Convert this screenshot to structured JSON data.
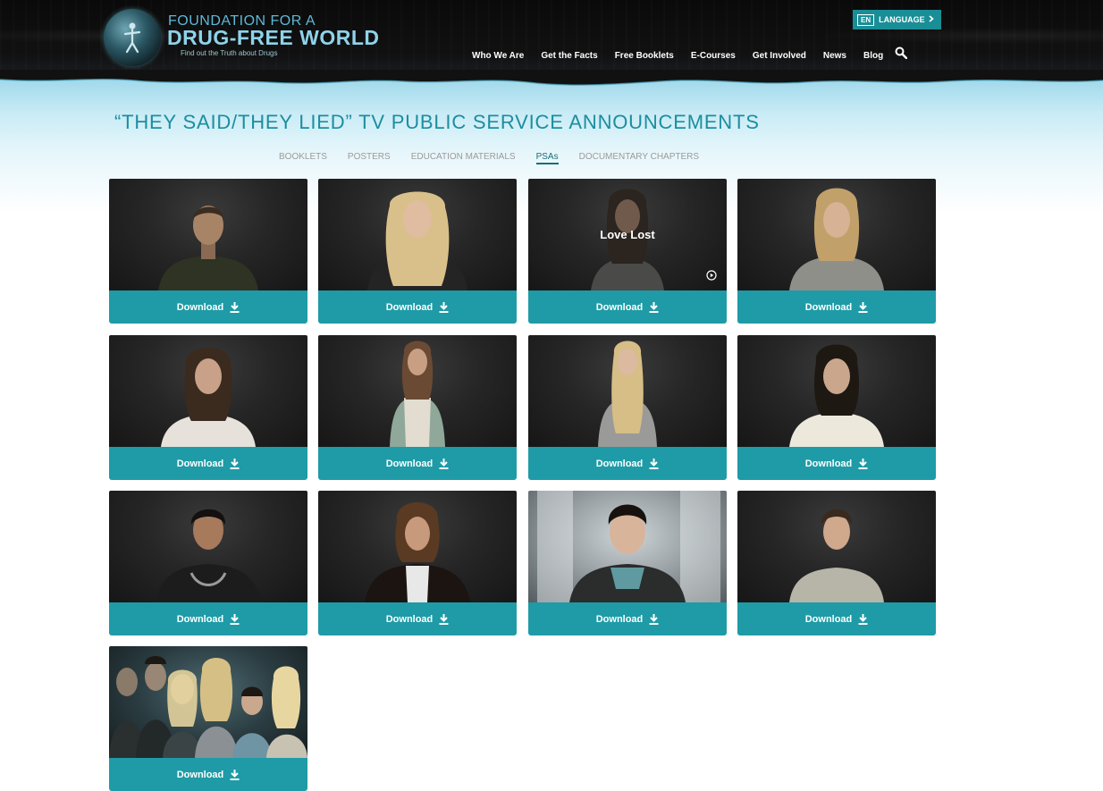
{
  "header": {
    "logo": {
      "line1": "FOUNDATION FOR A",
      "line2": "DRUG-FREE WORLD",
      "tagline": "Find out the Truth about Drugs"
    },
    "language": {
      "code": "EN",
      "label": "LANGUAGE"
    },
    "nav": [
      "Who We Are",
      "Get the Facts",
      "Free Booklets",
      "E-Courses",
      "Get Involved",
      "News",
      "Blog"
    ]
  },
  "page": {
    "title": "“THEY SAID/THEY LIED” TV PUBLIC SERVICE ANNOUNCEMENTS",
    "tabs": [
      "BOOKLETS",
      "POSTERS",
      "EDUCATION MATERIALS",
      "PSAs",
      "DOCUMENTARY CHAPTERS"
    ],
    "active_tab": "PSAs"
  },
  "cards": [
    {
      "download_label": "Download"
    },
    {
      "download_label": "Download"
    },
    {
      "download_label": "Download",
      "overlay_title": "Love Lost"
    },
    {
      "download_label": "Download"
    },
    {
      "download_label": "Download"
    },
    {
      "download_label": "Download"
    },
    {
      "download_label": "Download"
    },
    {
      "download_label": "Download"
    },
    {
      "download_label": "Download"
    },
    {
      "download_label": "Download"
    },
    {
      "download_label": "Download"
    },
    {
      "download_label": "Download"
    },
    {
      "download_label": "Download"
    }
  ],
  "colors": {
    "accent": "#1e9ba6",
    "title": "#1b8e9f",
    "header_bg": "#0a0a0a"
  },
  "icons": [
    "search-icon",
    "chevron-right-icon",
    "download-icon",
    "play-icon"
  ]
}
